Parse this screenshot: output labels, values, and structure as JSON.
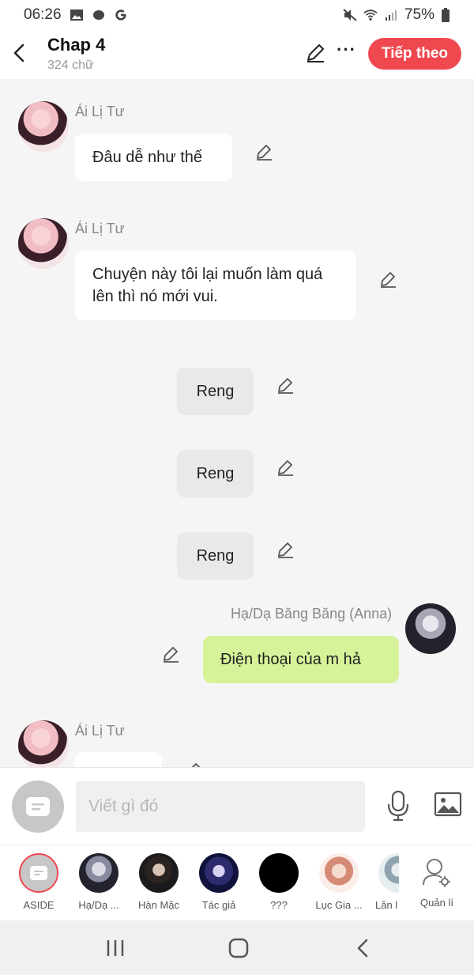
{
  "status_bar": {
    "time": "06:26",
    "battery": "75%"
  },
  "header": {
    "title": "Chap 4",
    "subtitle": "324 chữ",
    "next_label": "Tiếp theo"
  },
  "messages": [
    {
      "sender": "Ái Lị Tư",
      "text": "Đâu dễ như thế"
    },
    {
      "sender": "Ái Lị Tư",
      "text": "Chuyện này tôi lại muốn làm quá lên thì nó mới vui."
    },
    {
      "text": "Reng"
    },
    {
      "text": "Reng"
    },
    {
      "text": "Reng"
    },
    {
      "sender": "Hạ/Dạ Băng Băng (Anna)",
      "text": "Điện thoại của m hả"
    },
    {
      "sender": "Ái Lị Tư"
    }
  ],
  "composer": {
    "placeholder": "Viết gì đó"
  },
  "characters": [
    {
      "name": "ASIDE"
    },
    {
      "name": "Hạ/Dạ ..."
    },
    {
      "name": "Hàn Mặc"
    },
    {
      "name": "Tác giả"
    },
    {
      "name": "???"
    },
    {
      "name": "Lục Gia ..."
    },
    {
      "name": "Lăn l"
    },
    {
      "name": "Quản lí"
    }
  ],
  "colors": {
    "accent": "#f0484f",
    "self_bubble": "#d7f39a",
    "narration_bubble": "#e9e9e9"
  }
}
